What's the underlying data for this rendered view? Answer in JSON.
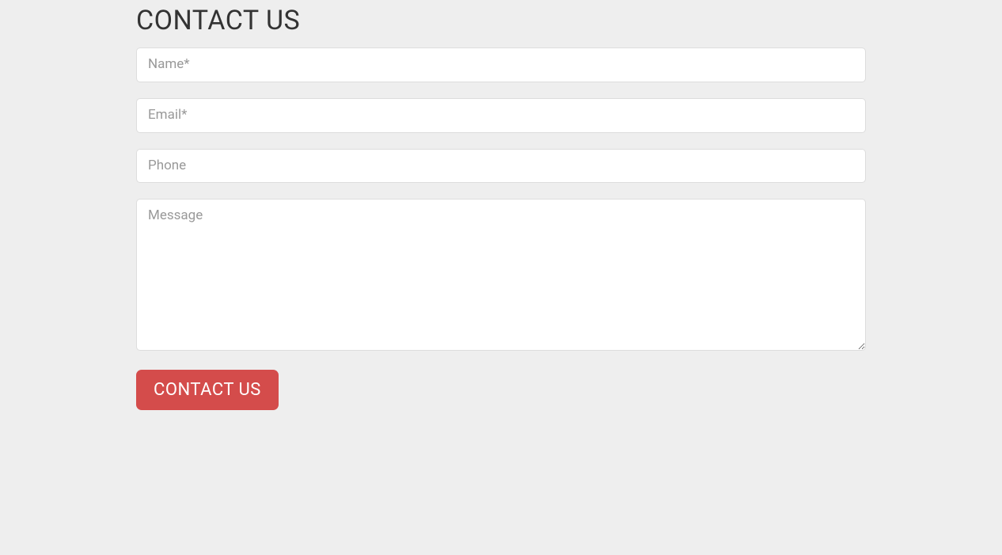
{
  "page": {
    "title": "CONTACT US"
  },
  "form": {
    "name": {
      "placeholder": "Name*",
      "value": ""
    },
    "email": {
      "placeholder": "Email*",
      "value": ""
    },
    "phone": {
      "placeholder": "Phone",
      "value": ""
    },
    "message": {
      "placeholder": "Message",
      "value": ""
    },
    "submit_label": "CONTACT US"
  }
}
